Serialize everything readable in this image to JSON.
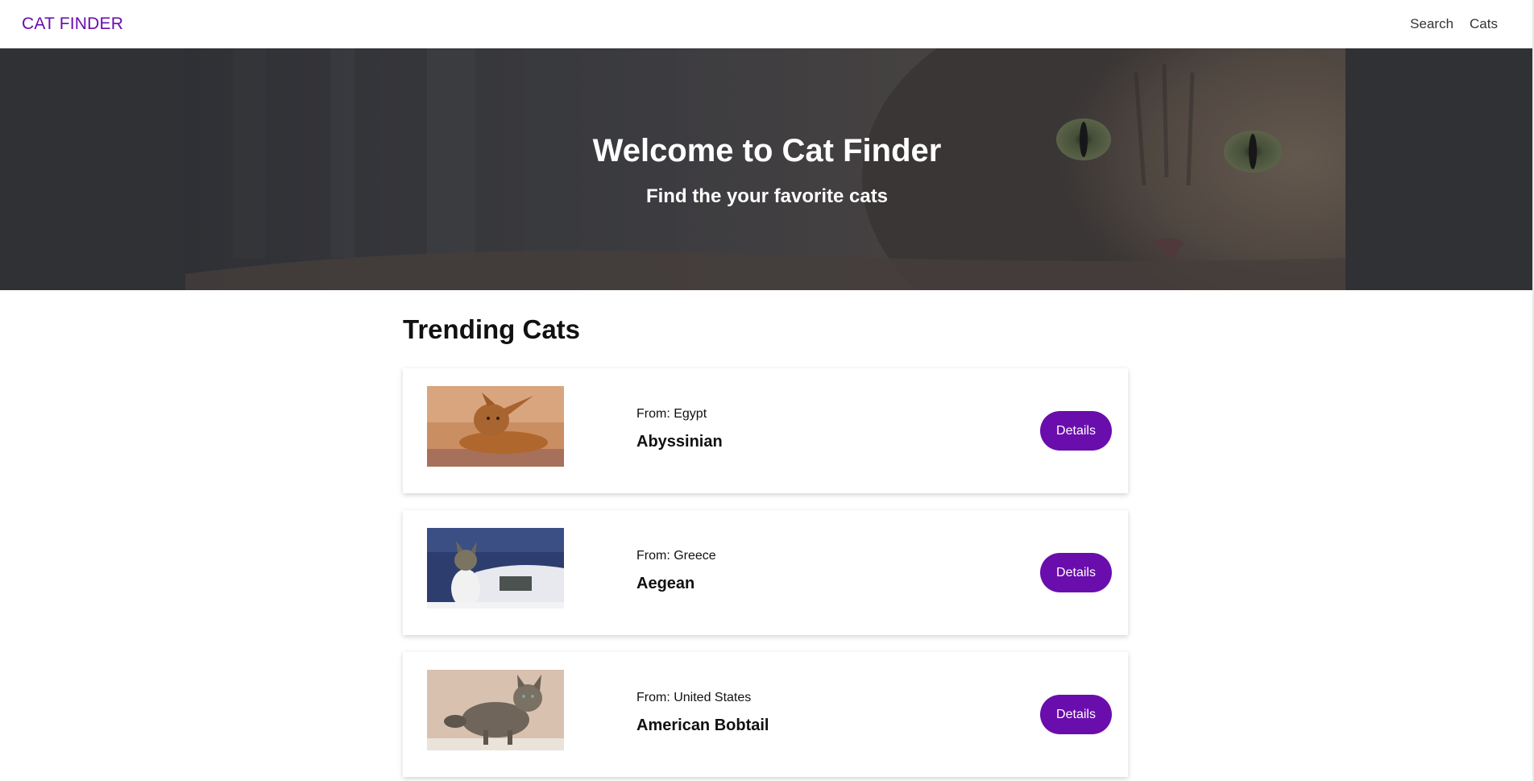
{
  "navbar": {
    "brand": "CAT FINDER",
    "links": [
      "Search",
      "Cats"
    ],
    "brand_color": "#6a0dad"
  },
  "hero": {
    "title": "Welcome to Cat Finder",
    "subtitle": "Find the your favorite cats"
  },
  "trending": {
    "title": "Trending Cats",
    "cards": [
      {
        "origin": "From: Egypt",
        "name": "Abyssinian",
        "button": "Details",
        "image": "abyssinian-cat-photo"
      },
      {
        "origin": "From: Greece",
        "name": "Aegean",
        "button": "Details",
        "image": "aegean-cat-photo"
      },
      {
        "origin": "From: United States",
        "name": "American Bobtail",
        "button": "Details",
        "image": "american-bobtail-cat-photo"
      }
    ]
  },
  "colors": {
    "accent": "#6a0dad",
    "hero_bg": "#303135"
  }
}
